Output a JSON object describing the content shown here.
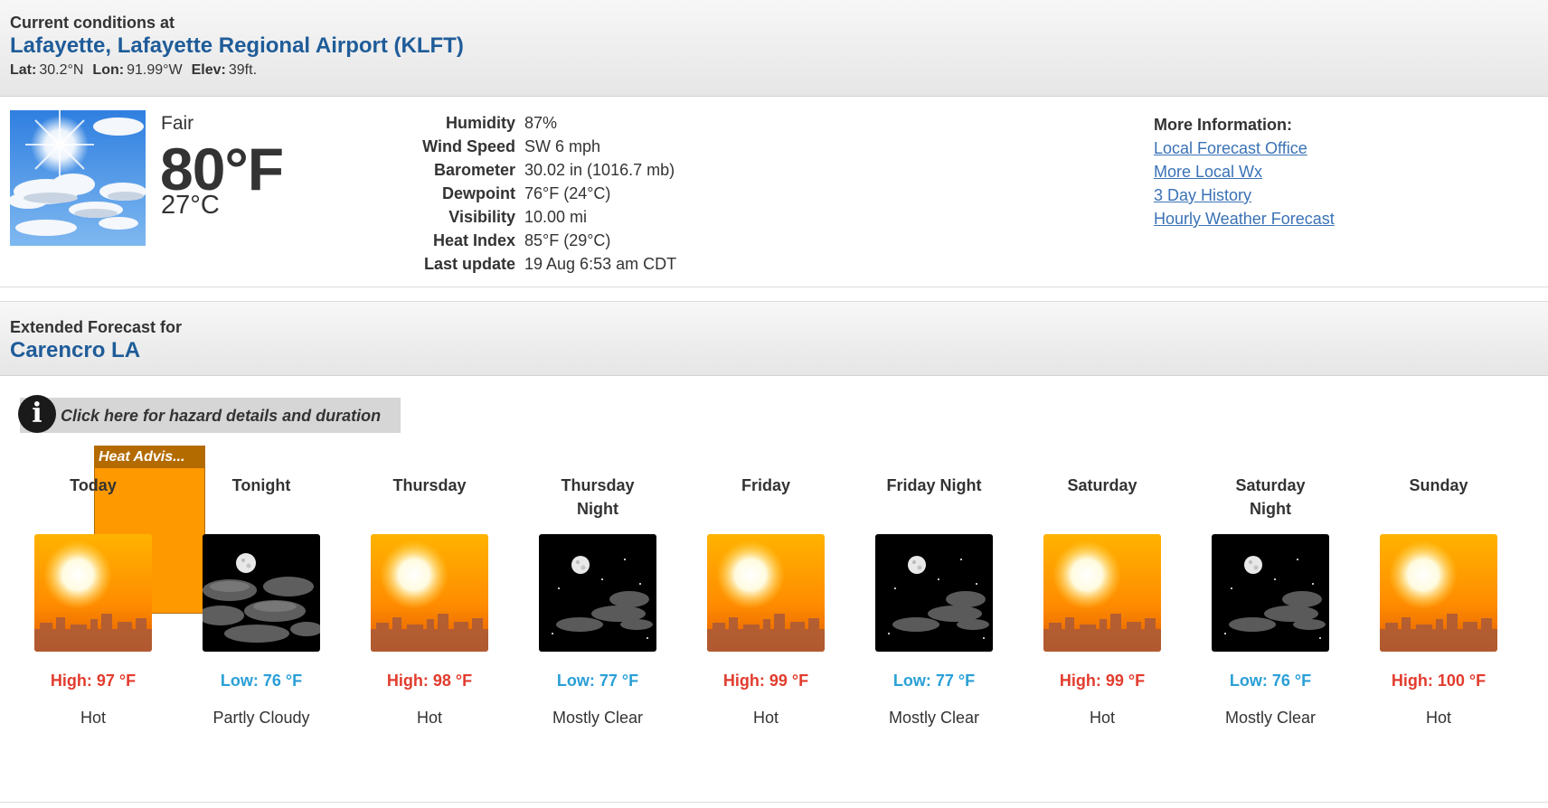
{
  "current": {
    "header_label": "Current conditions at",
    "station": "Lafayette, Lafayette Regional Airport (KLFT)",
    "lat_label": "Lat:",
    "lat": "30.2°N",
    "lon_label": "Lon:",
    "lon": "91.99°W",
    "elev_label": "Elev:",
    "elev": "39ft.",
    "condition": "Fair",
    "temp_f": "80°F",
    "temp_c": "27°C",
    "details": [
      {
        "label": "Humidity",
        "value": "87%"
      },
      {
        "label": "Wind Speed",
        "value": "SW 6 mph"
      },
      {
        "label": "Barometer",
        "value": "30.02 in (1016.7 mb)"
      },
      {
        "label": "Dewpoint",
        "value": "76°F (24°C)"
      },
      {
        "label": "Visibility",
        "value": "10.00 mi"
      },
      {
        "label": "Heat Index",
        "value": "85°F (29°C)"
      },
      {
        "label": "Last update",
        "value": "19 Aug 6:53 am CDT"
      }
    ],
    "more_info": {
      "title": "More Information:",
      "links": [
        "Local Forecast Office",
        "More Local Wx",
        "3 Day History",
        "Hourly Weather Forecast"
      ]
    }
  },
  "extended": {
    "header_label": "Extended Forecast for",
    "location": "Carencro LA",
    "hazard_text": "Click here for hazard details and duration",
    "advisory_label": "Heat Advis...",
    "periods": [
      {
        "name": "Today",
        "icon": "hot-sun-icon",
        "temp": "High: 97 °F",
        "kind": "high",
        "desc": "Hot"
      },
      {
        "name": "Tonight",
        "icon": "partly-cloudy-night-icon",
        "temp": "Low: 76 °F",
        "kind": "low",
        "desc": "Partly Cloudy"
      },
      {
        "name": "Thursday",
        "icon": "hot-sun-icon",
        "temp": "High: 98 °F",
        "kind": "high",
        "desc": "Hot"
      },
      {
        "name": "Thursday Night",
        "icon": "mostly-clear-night-icon",
        "temp": "Low: 77 °F",
        "kind": "low",
        "desc": "Mostly Clear"
      },
      {
        "name": "Friday",
        "icon": "hot-sun-icon",
        "temp": "High: 99 °F",
        "kind": "high",
        "desc": "Hot"
      },
      {
        "name": "Friday Night",
        "icon": "mostly-clear-night-icon",
        "temp": "Low: 77 °F",
        "kind": "low",
        "desc": "Mostly Clear"
      },
      {
        "name": "Saturday",
        "icon": "hot-sun-icon",
        "temp": "High: 99 °F",
        "kind": "high",
        "desc": "Hot"
      },
      {
        "name": "Saturday Night",
        "icon": "mostly-clear-night-icon",
        "temp": "Low: 76 °F",
        "kind": "low",
        "desc": "Mostly Clear"
      },
      {
        "name": "Sunday",
        "icon": "hot-sun-icon",
        "temp": "High: 100 °F",
        "kind": "high",
        "desc": "Hot"
      }
    ]
  },
  "colors": {
    "title_blue": "#1f5c99",
    "link_blue": "#3a72b5",
    "high_red": "#e23c2e",
    "low_blue": "#2a9fd6",
    "advisory_orange": "#ff9900",
    "advisory_label_bg": "#b36b00"
  }
}
